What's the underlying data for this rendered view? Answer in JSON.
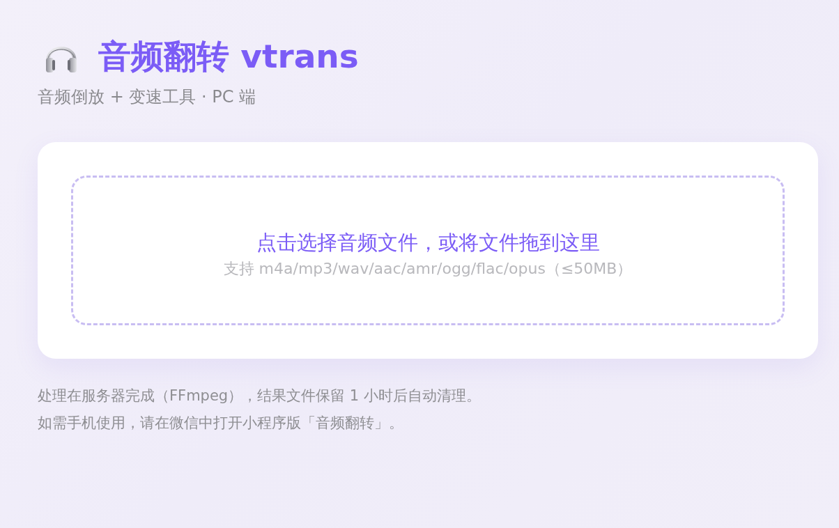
{
  "header": {
    "title": "音频翻转 vtrans",
    "subtitle": "音频倒放 + 变速工具 · PC 端"
  },
  "upload": {
    "prompt": "点击选择音频文件，或将文件拖到这里",
    "hint": "支持 m4a/mp3/wav/aac/amr/ogg/flac/opus（≤50MB）"
  },
  "notes": [
    "处理在服务器完成（FFmpeg），结果文件保留 1 小时后自动清理。",
    "如需手机使用，请在微信中打开小程序版「音频翻转」。"
  ]
}
